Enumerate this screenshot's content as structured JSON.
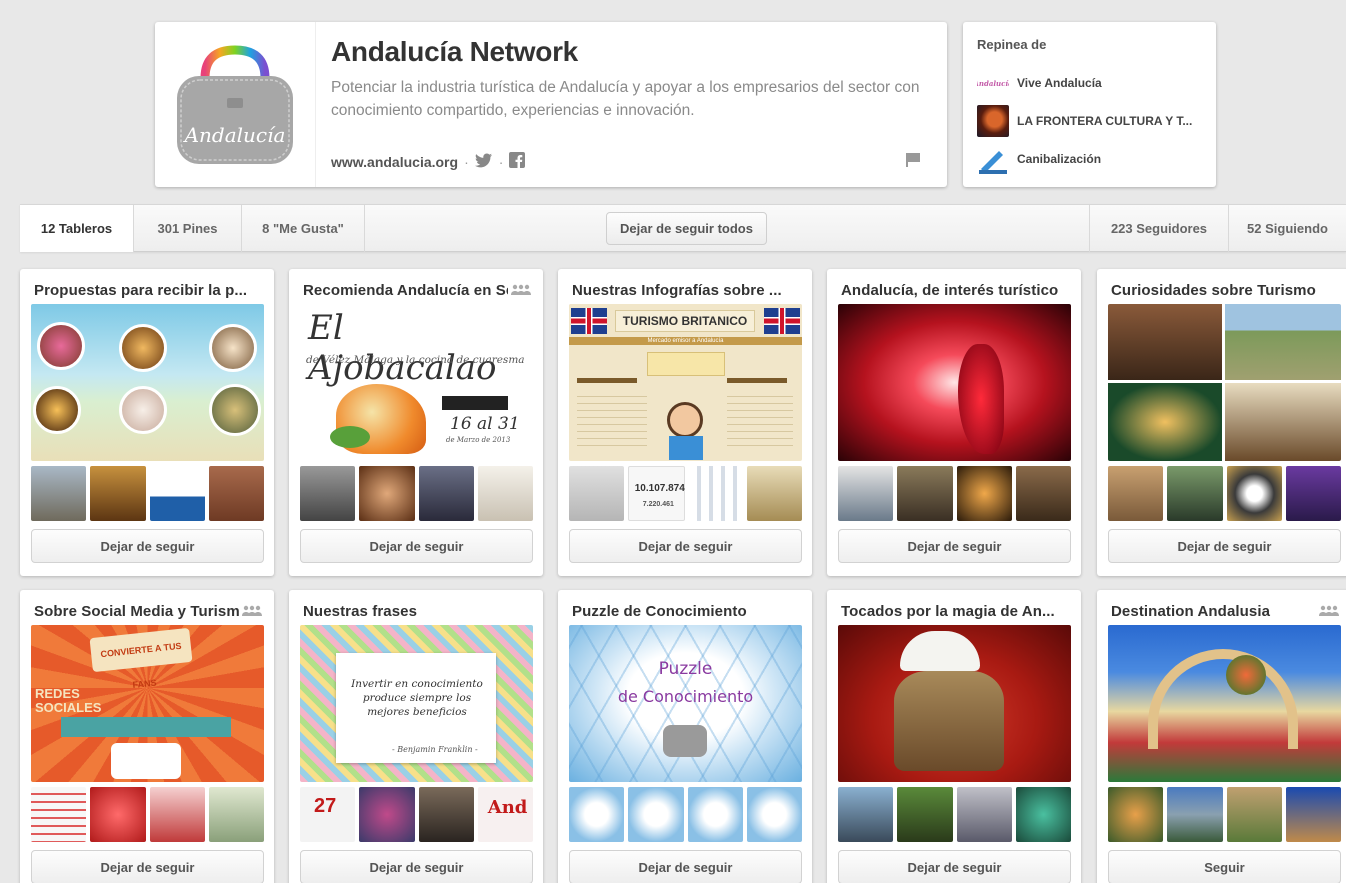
{
  "profile": {
    "name": "Andalucía Network",
    "about": "Potenciar la industria turística de Andalucía y apoyar a los empresarios del sector con conocimiento compartido, experiencias e innovación.",
    "website": "www.andalucia.org",
    "separator": "·",
    "logo_text": "Andalucía",
    "icons": [
      "twitter-icon",
      "facebook-icon",
      "flag-icon"
    ]
  },
  "repins": {
    "title": "Repinea de",
    "items": [
      {
        "label": "Vive Andalucía"
      },
      {
        "label": "LA FRONTERA CULTURA Y T..."
      },
      {
        "label": "Canibalización"
      }
    ]
  },
  "tabs": {
    "boards": "12 Tableros",
    "pins": "301 Pines",
    "likes": "8 \"Me Gusta\"",
    "unfollow_all": "Dejar de seguir todos",
    "followers": "223 Seguidores",
    "following": "52 Siguiendo"
  },
  "boards": [
    {
      "title": "Propuestas para recibir la p...",
      "button": "Dejar de seguir",
      "collab": false
    },
    {
      "title": "Recomienda Andalucía en Semana Santa",
      "button": "Dejar de seguir",
      "collab": true,
      "cover_text": {
        "line1": "El Ajobacalao",
        "line2": "de Vélez Málaga y la cocina de cuaresma",
        "date": "16 al 31",
        "date_sub": "de Marzo de 2013"
      }
    },
    {
      "title": "Nuestras Infografías sobre ...",
      "button": "Dejar de seguir",
      "collab": false,
      "cover_text": {
        "banner": "TURISMO BRITANICO",
        "sub": "Mercado emisor a Andalucía",
        "stat": "10.107.874",
        "stat2": "7.220.461"
      }
    },
    {
      "title": "Andalucía, de interés turístico",
      "button": "Dejar de seguir",
      "collab": false
    },
    {
      "title": "Curiosidades sobre Turismo",
      "button": "Dejar de seguir",
      "collab": false
    },
    {
      "title": "Sobre Social Media y Turismo",
      "button": "Dejar de seguir",
      "collab": true,
      "cover_text": {
        "line1": "REDES SOCIALES",
        "line2": "CONVIERTE A TUS FANS"
      }
    },
    {
      "title": "Nuestras frases",
      "button": "Dejar de seguir",
      "collab": false,
      "cover_text": {
        "quote": "Invertir en conocimiento produce siempre los mejores beneficios",
        "author": "- Benjamin Franklin -",
        "thumb1": "27",
        "thumb4": "And"
      }
    },
    {
      "title": "Puzzle de Conocimiento",
      "button": "Dejar de seguir",
      "collab": false,
      "cover_text": {
        "line1": "Puzzle",
        "line2": "de Conocimiento"
      }
    },
    {
      "title": "Tocados por la magia de An...",
      "button": "Dejar de seguir",
      "collab": false
    },
    {
      "title": "Destination Andalusia",
      "button": "Seguir",
      "collab": true
    }
  ],
  "colors": {
    "background": "#e8e8e8",
    "card": "#ffffff",
    "text": "#333333",
    "muted": "#8a8a8a"
  }
}
